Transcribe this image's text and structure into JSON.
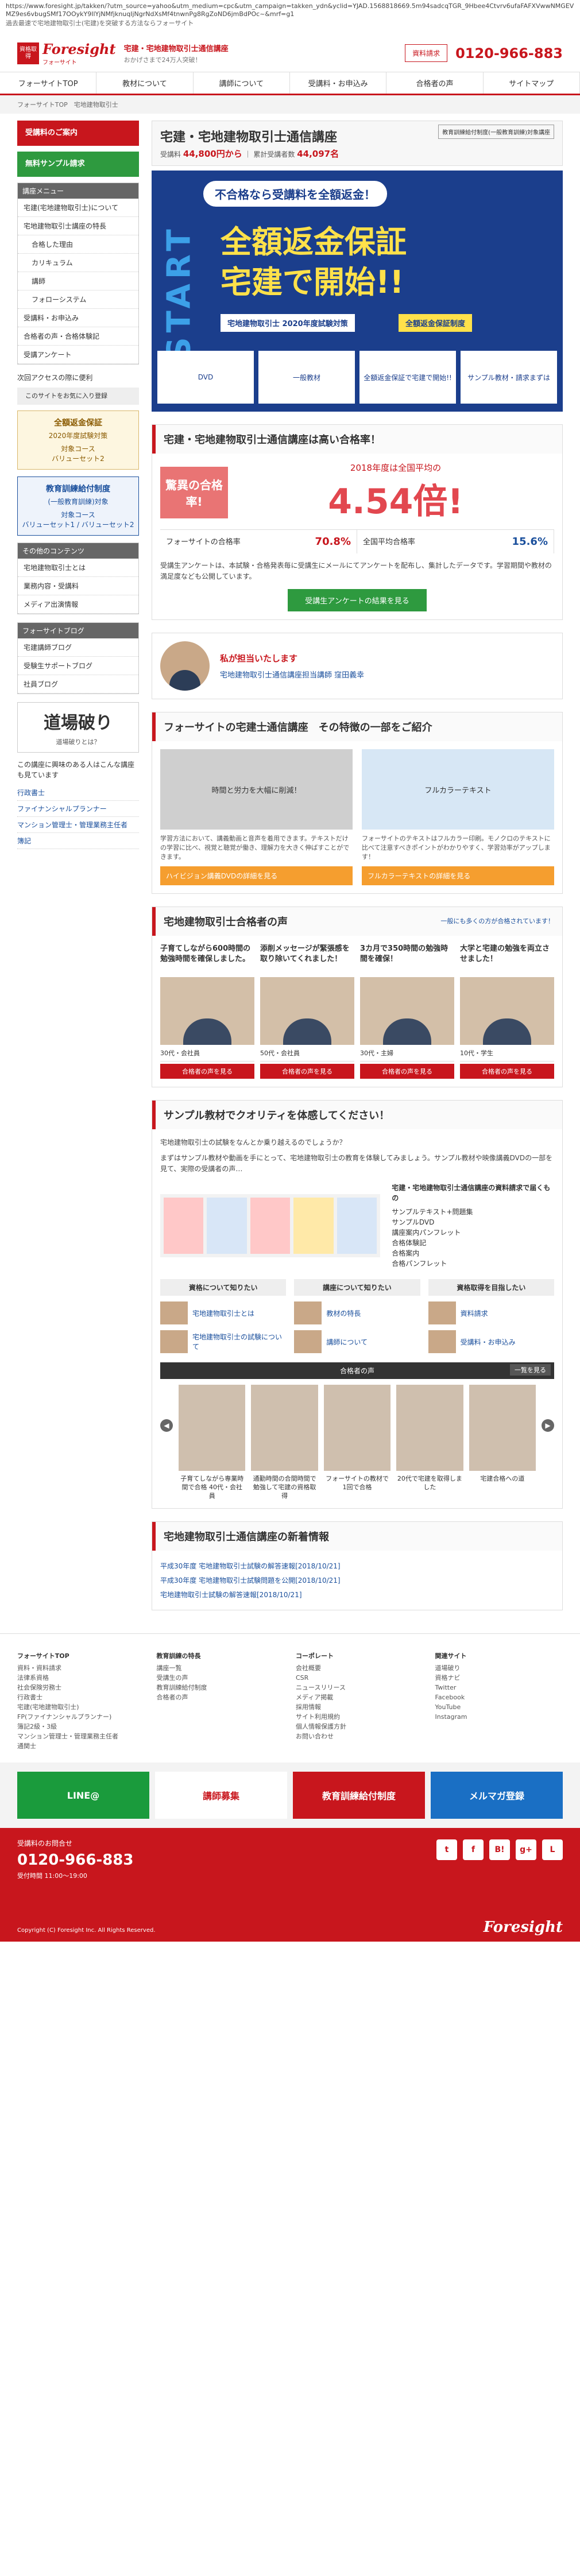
{
  "url": "https://www.foresight.jp/takken/?utm_source=yahoo&utm_medium=cpc&utm_campaign=takken_ydn&yclid=YJAD.1568818669.5m94sadcqTGR_9Hbee4Ctvrv6ufaFAFXVwwNMGEVMZ9es6vbugSMf17OOykY9IlYjNMfjknuqIjNgrNdXsMf4tnwnPg8RgZoND6jmBdPOc~&mrf=g1",
  "subline": "過去最速で宅地建物取引士(宅建)を突破する方法ならフォーサイト",
  "header": {
    "badge": "資格取得",
    "logo": "Foresight",
    "logo_sub": "フォーサイト",
    "tagline1": "宅建・宅地建物取引士通信講座",
    "tagline2": "おかげさまで24万人突破！",
    "contact": "資料請求",
    "phone": "0120-966-883"
  },
  "gnav": [
    "フォーサイトTOP",
    "教材について",
    "講師について",
    "受講料・お申込み",
    "合格者の声",
    "サイトマップ"
  ],
  "breadcrumb": "フォーサイトTOP　宅地建物取引士",
  "side": {
    "apply": "受講料のご案内",
    "sample": "無料サンプル請求",
    "menu_title": "講座メニュー",
    "menu": [
      "宅建(宅地建物取引士)について",
      "宅地建物取引士講座の特長",
      "合格した理由",
      "カリキュラム",
      "講師",
      "フォローシステム",
      "受講料・お申込み",
      "合格者の声・合格体験記",
      "受講アンケート"
    ],
    "menu_sub": [
      false,
      false,
      true,
      true,
      true,
      true,
      false,
      false,
      false
    ],
    "next": "次回アクセスの際に便利",
    "bookmark": "このサイトをお気に入り登録",
    "gold_t": "全額返金保証",
    "gold_b": "2020年度試験対策",
    "gold_c": "対象コース",
    "gold_d": "バリューセット2",
    "blue_t": "教育訓練給付制度",
    "blue_b": "(一般教育訓練)対象",
    "blue_c": "対象コース",
    "blue_d": "バリューセット1 / バリューセット2",
    "other_title": "その他のコンテンツ",
    "other": [
      "宅地建物取引士とは",
      "業務内容・受講料",
      "メディア出演情報"
    ],
    "blog_title": "フォーサイトブログ",
    "blog": [
      "宅建講師ブログ",
      "受験生サポートブログ",
      "社員ブログ"
    ],
    "dojo": "道場破り",
    "dojo_q": "道場破りとは？",
    "interest": "この講座に興味のある人はこんな講座も見ています",
    "related": [
      "行政書士",
      "ファイナンシャルプランナー",
      "マンション管理士・管理業務主任者",
      "簿記"
    ]
  },
  "course": {
    "title": "宅建・宅地建物取引士通信講座",
    "stat1_l": "受講料",
    "stat1": "44,800円から",
    "stat2_l": "累計受講者数",
    "stat2": "44,097名",
    "note": "教育訓練給付制度(一般教育訓練)対象講座"
  },
  "hero": {
    "vertical": "START",
    "pill": "不合格なら受講料を全額返金！",
    "line1": "全額返金保証",
    "line2": "宅建で開始!!",
    "ribbon1": "宅地建物取引士 2020年度試験対策",
    "ribbon2": "全額返金保証制度",
    "strip": [
      "DVD",
      "一般教材",
      "全額返金保証で宅建で開始!!",
      "サンプル教材・請求まずは"
    ]
  },
  "pass": {
    "heading": "宅建・宅地建物取引士通信講座は高い合格率！",
    "label": "驚異の合格率!",
    "caption": "2018年度は全国平均の",
    "rate": "4.54倍!",
    "row_l1": "フォーサイトの合格率",
    "row_v1": "70.8%",
    "row_l2": "全国平均合格率",
    "row_v2": "15.6%",
    "desc": "受講生アンケートは、本試験・合格発表毎に受講生にメールにてアンケートを配布し、集計したデータです。学習期間や教材の満足度なども公開しています。",
    "btn": "受講生アンケートの結果を見る"
  },
  "teacher": {
    "title": "私が担当いたします",
    "name": "宅地建物取引士通信講座担当講師 窪田義幸"
  },
  "feature": {
    "heading": "フォーサイトの宅建士通信講座　その特徴の一部をご紹介",
    "c1_img": "時間と労力を大幅に削減！",
    "c1_txt": "学習方法において、講義動画と音声を着用できます。テキストだけの学習に比べ、視覚と聴覚が働き、理解力を大きく伸ばすことができます。",
    "c1_btn": "ハイビジョン講義DVDの詳細を見る",
    "c2_img": "フルカラーテキスト",
    "c2_txt": "フォーサイトのテキストはフルカラー印刷。モノクロのテキストに比べて注意すべきポイントがわかりやすく、学習効率がアップします！",
    "c2_btn": "フルカラーテキストの詳細を見る"
  },
  "voices": {
    "heading": "宅地建物取引士合格者の声",
    "link": "一般にも多くの方が合格されています！",
    "items": [
      {
        "title": "子育てしながら600時間の勉強時間を確保しました。",
        "meta": "30代・会社員",
        "btn": "合格者の声を見る"
      },
      {
        "title": "添削メッセージが緊張感を取り除いてくれました！",
        "meta": "50代・会社員",
        "btn": "合格者の声を見る"
      },
      {
        "title": "3カ月で350時間の勉強時間を確保！",
        "meta": "30代・主婦",
        "btn": "合格者の声を見る"
      },
      {
        "title": "大学と宅建の勉強を両立させました！",
        "meta": "10代・学生",
        "btn": "合格者の声を見る"
      }
    ]
  },
  "sample": {
    "heading": "サンプル教材でクオリティを体感してください！",
    "p1": "宅地建物取引士の試験をなんとか乗り越えるのでしょうか？",
    "p2": "まずはサンプル教材や動画を手にとって、宅地建物取引士の教育を体験してみましょう。サンプル教材や映像講義DVDの一部を見て、実際の受講者の声…",
    "list_h": "宅建・宅地建物取引士通信講座の資料請求で届くもの",
    "list": [
      "サンプルテキスト+問題集",
      "サンプルDVD",
      "講座案内パンフレット",
      "合格体験記",
      "合格案内",
      "合格パンフレット"
    ]
  },
  "grid": [
    {
      "h": "資格について知りたい",
      "items": [
        "宅地建物取引士とは",
        "宅地建物取引士の試験について"
      ]
    },
    {
      "h": "講座について知りたい",
      "items": [
        "教材の特長",
        "講師について"
      ]
    },
    {
      "h": "資格取得を目指したい",
      "items": [
        "資料請求",
        "受講料・お申込み"
      ]
    }
  ],
  "slider": {
    "bar": "合格者の声",
    "more": "一覧を見る",
    "items": [
      "子育てしながら専業時間で合格 40代・会社員",
      "通勤時間の合間時間で勉強して宅建の資格取得",
      "フォーサイトの教材で1回で合格",
      "20代で宅建を取得しました",
      "宅建合格への道"
    ]
  },
  "news": {
    "heading": "宅地建物取引士通信講座の新着情報",
    "items": [
      "平成30年度 宅地建物取引士試験の解答速報[2018/10/21]",
      "平成30年度 宅地建物取引士試験問題を公開[2018/10/21]",
      "宅地建物取引士試験の解答速報[2018/10/21]"
    ]
  },
  "footer": {
    "cols": [
      {
        "h": "フォーサイトTOP",
        "items": [
          "資料・資料請求",
          "法律系資格",
          "社会保険労務士",
          "行政書士",
          "宅建(宅地建物取引士)",
          "FP(ファイナンシャルプランナー)",
          "簿記2級・3級",
          "マンション管理士・管理業務主任者",
          "通関士"
        ]
      },
      {
        "h": "教育訓練の特長",
        "items": [
          "講座一覧",
          "受講生の声",
          "教育訓練給付制度",
          "合格者の声"
        ]
      },
      {
        "h": "コーポレート",
        "items": [
          "会社概要",
          "CSR",
          "ニュースリリース",
          "メディア掲載",
          "採用情報",
          "サイト利用規約",
          "個人情報保護方針",
          "お問い合わせ"
        ]
      },
      {
        "h": "関連サイト",
        "items": [
          "道場破り",
          "資格ナビ",
          "Twitter",
          "Facebook",
          "YouTube",
          "Instagram"
        ]
      }
    ]
  },
  "banners": [
    "LINE@",
    "講師募集",
    "教育訓練給付制度",
    "メルマガ登録"
  ],
  "ftr": {
    "label": "受講料のお問合せ",
    "phone": "0120-966-883",
    "hours": "受付時間 11:00〜19:00",
    "social": [
      "t",
      "f",
      "B!",
      "g+",
      "L"
    ],
    "copy": "Copyright (C) Foresight Inc. All Rights Reserved.",
    "logo": "Foresight"
  }
}
